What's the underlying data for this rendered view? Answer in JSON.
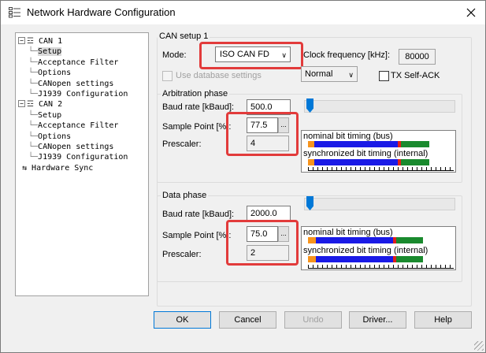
{
  "window": {
    "title": "Network Hardware Configuration",
    "close_icon": "close-icon"
  },
  "tree": [
    {
      "label": "CAN 1",
      "kind": "node",
      "icon": "can-channel-icon"
    },
    {
      "label": "Setup",
      "kind": "leaf",
      "selected": true
    },
    {
      "label": "Acceptance Filter",
      "kind": "leaf"
    },
    {
      "label": "Options",
      "kind": "leaf"
    },
    {
      "label": "CANopen settings",
      "kind": "leaf"
    },
    {
      "label": "J1939 Configuration",
      "kind": "leaf"
    },
    {
      "label": "CAN 2",
      "kind": "node",
      "icon": "can-channel-icon"
    },
    {
      "label": "Setup",
      "kind": "leaf"
    },
    {
      "label": "Acceptance Filter",
      "kind": "leaf"
    },
    {
      "label": "Options",
      "kind": "leaf"
    },
    {
      "label": "CANopen settings",
      "kind": "leaf"
    },
    {
      "label": "J1939 Configuration",
      "kind": "leaf"
    },
    {
      "label": "Hardware Sync",
      "kind": "root-leaf",
      "icon": "sync-icon"
    }
  ],
  "can_setup": {
    "group_label": "CAN setup 1",
    "mode_label": "Mode:",
    "mode_value": "ISO CAN FD",
    "clock_label": "Clock frequency [kHz]:",
    "clock_value": "80000",
    "use_db_label": "Use database settings",
    "normal_value": "Normal",
    "tx_ack_label": "TX Self-ACK"
  },
  "arbitration": {
    "group_label": "Arbitration phase",
    "baud_label": "Baud rate [kBaud]:",
    "baud_value": "500.0",
    "sample_label": "Sample Point [%]:",
    "sample_value": "77.5",
    "prescaler_label": "Prescaler:",
    "prescaler_value": "4",
    "dots": "...",
    "nominal_label": "nominal bit timing (bus)",
    "sync_label": "synchronized bit timing (internal)",
    "slider_position": 0.02
  },
  "data_phase": {
    "group_label": "Data phase",
    "baud_label": "Baud rate [kBaud]:",
    "baud_value": "2000.0",
    "sample_label": "Sample Point [%]:",
    "sample_value": "75.0",
    "prescaler_label": "Prescaler:",
    "prescaler_value": "2",
    "dots": "...",
    "nominal_label": "nominal bit timing (bus)",
    "sync_label": "synchronized bit timing (internal)",
    "slider_position": 0.02
  },
  "buttons": {
    "ok": "OK",
    "cancel": "Cancel",
    "undo": "Undo",
    "driver": "Driver...",
    "help": "Help"
  },
  "colors": {
    "highlight": "#e23b3b",
    "timing_orange": "#f7941d",
    "timing_blue": "#1a1ae6",
    "timing_red": "#e0201b",
    "timing_green": "#1a8a2e",
    "slider": "#0078d7"
  }
}
